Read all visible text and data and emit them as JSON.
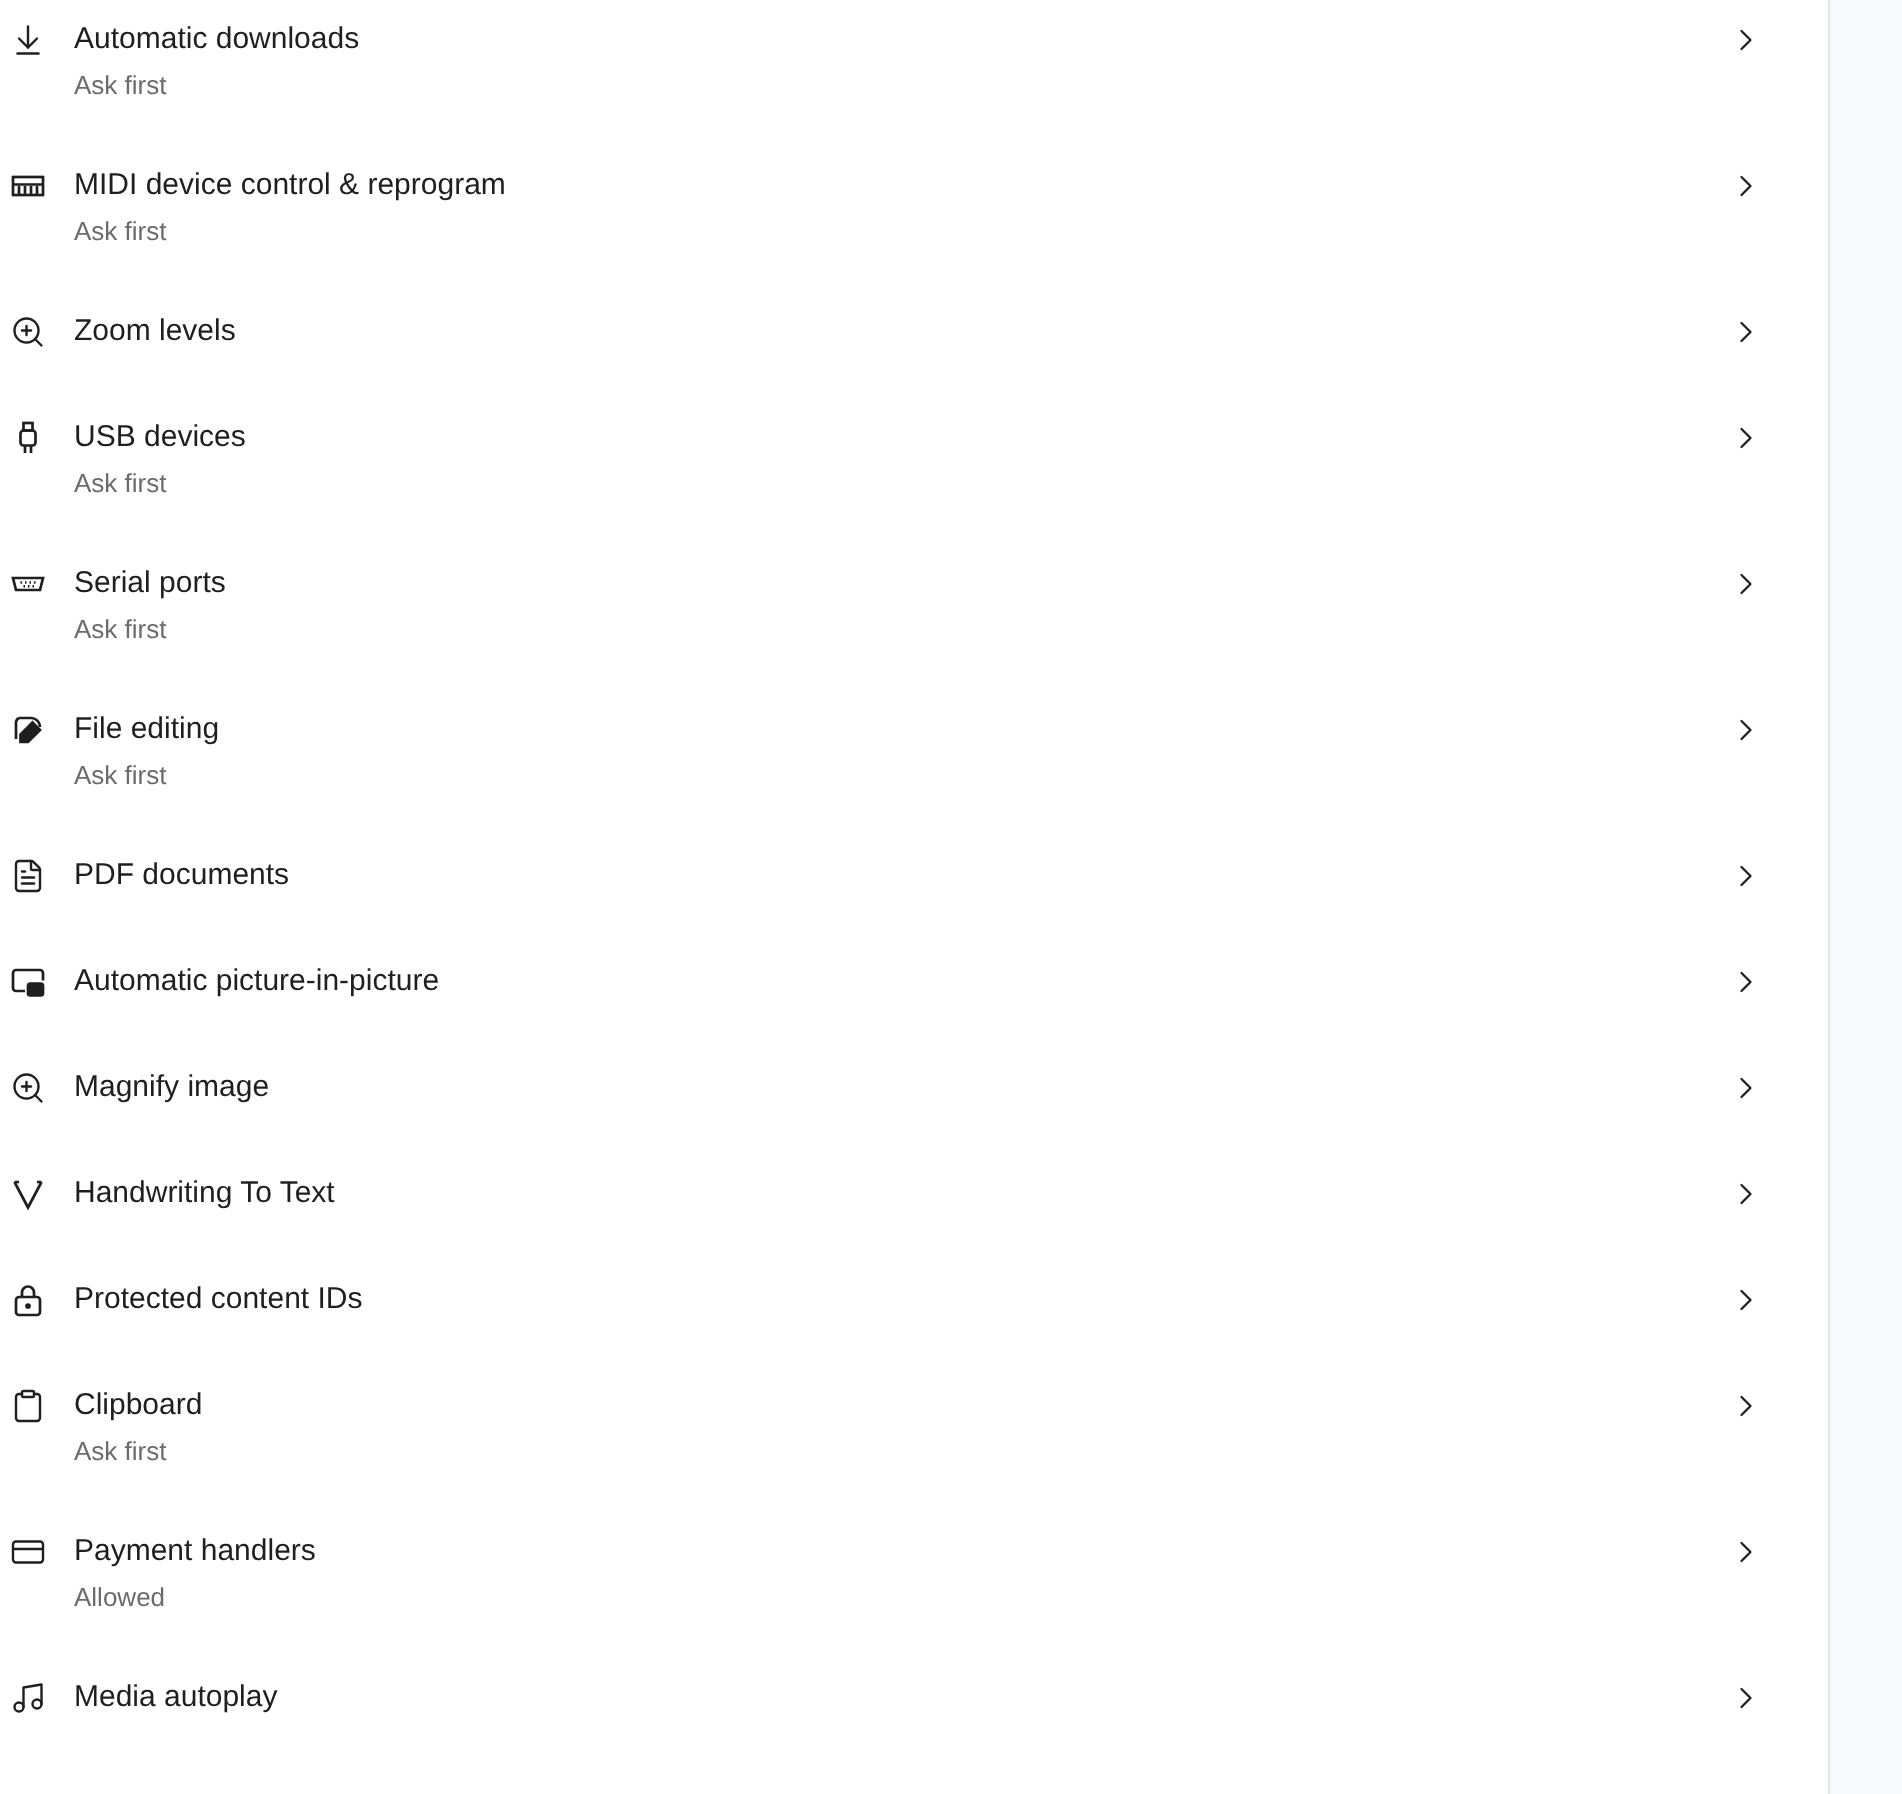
{
  "settings": [
    {
      "title": "Automatic downloads",
      "status": "Ask first"
    },
    {
      "title": "MIDI device control & reprogram",
      "status": "Ask first"
    },
    {
      "title": "Zoom levels"
    },
    {
      "title": "USB devices",
      "status": "Ask first"
    },
    {
      "title": "Serial ports",
      "status": "Ask first"
    },
    {
      "title": "File editing",
      "status": "Ask first"
    },
    {
      "title": "PDF documents"
    },
    {
      "title": "Automatic picture-in-picture"
    },
    {
      "title": "Magnify image"
    },
    {
      "title": "Handwriting To Text"
    },
    {
      "title": "Protected content IDs"
    },
    {
      "title": "Clipboard",
      "status": "Ask first"
    },
    {
      "title": "Payment handlers",
      "status": "Allowed"
    },
    {
      "title": "Media autoplay"
    }
  ]
}
